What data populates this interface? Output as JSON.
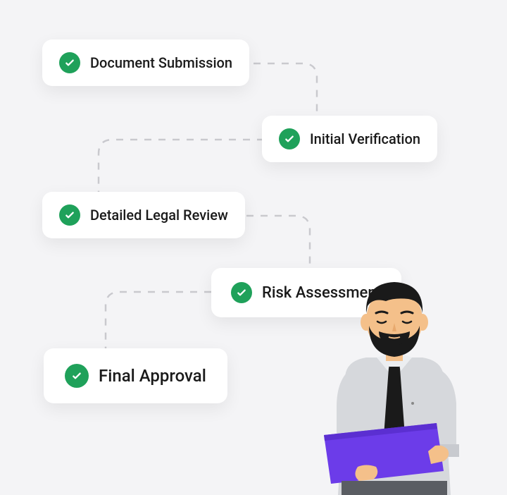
{
  "steps": [
    {
      "label": "Document Submission"
    },
    {
      "label": "Initial Verification"
    },
    {
      "label": "Detailed Legal Review"
    },
    {
      "label": "Risk Assessment"
    },
    {
      "label": "Final Approval"
    }
  ],
  "colors": {
    "check_bg": "#1fa15a",
    "tablet": "#6c3ce9",
    "connector": "#c9c9ce"
  }
}
